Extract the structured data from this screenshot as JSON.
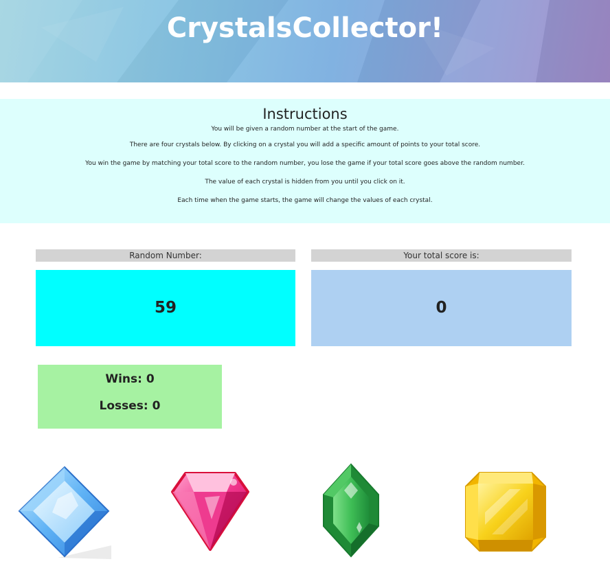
{
  "header": {
    "title": "CrystalsCollector!",
    "gradient_colors": [
      "#9fd3e0",
      "#7aaee0",
      "#a18bc9"
    ]
  },
  "instructions": {
    "heading": "Instructions",
    "lines": [
      "You will be given a random number at the start of the game.",
      "There are four crystals below. By clicking on a crystal you will add a specific amount of points to your total score.",
      "You win the game by matching your total score to the random number, you lose the game if your total score goes above the random number.",
      "The value of each crystal is hidden from you until you click on it.",
      "Each time when the game starts, the game will change the values of each crystal."
    ],
    "background": "#ddfffd"
  },
  "random_number": {
    "label": "Random Number:",
    "value": "59",
    "color": "#00ffff"
  },
  "total_score": {
    "label": "Your total score is:",
    "value": "0",
    "color": "#aed0f2"
  },
  "stats": {
    "wins_label": "Wins:",
    "wins": "0",
    "losses_label": "Losses:",
    "losses": "0",
    "color": "#a6f2a2"
  },
  "crystals": [
    {
      "name": "blue-diamond-crystal",
      "color": "#4da3f0"
    },
    {
      "name": "pink-gem-crystal",
      "color": "#e8186a"
    },
    {
      "name": "green-crystal",
      "color": "#2fa84a"
    },
    {
      "name": "yellow-crystal",
      "color": "#f5c518"
    }
  ]
}
